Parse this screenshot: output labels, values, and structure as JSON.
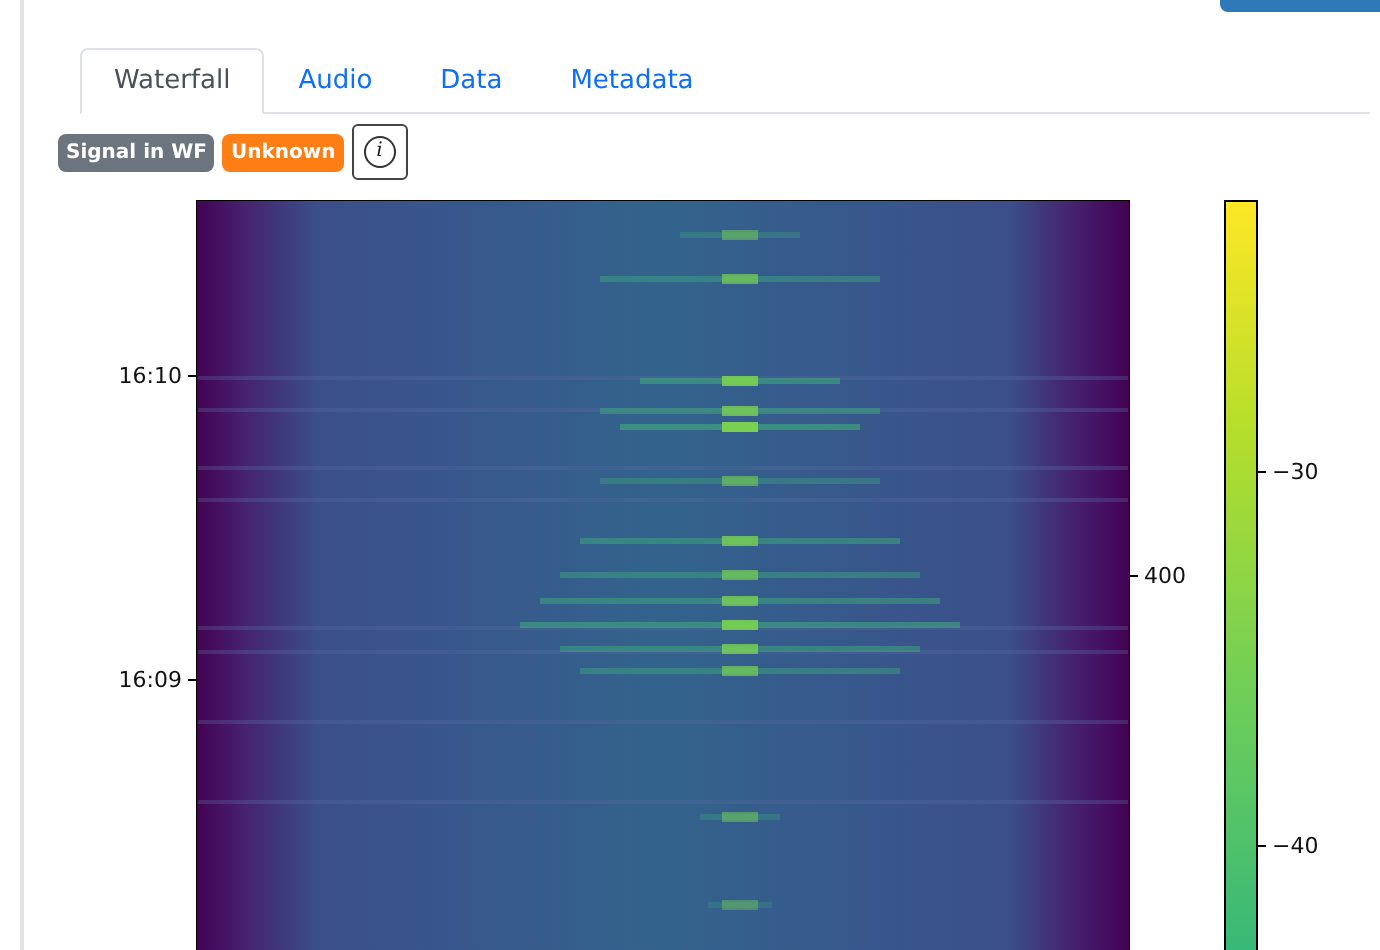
{
  "tabs": [
    {
      "label": "Waterfall",
      "selected": true
    },
    {
      "label": "Audio",
      "selected": false
    },
    {
      "label": "Data",
      "selected": false
    },
    {
      "label": "Metadata",
      "selected": false
    }
  ],
  "badges": [
    {
      "label": "Signal in WF",
      "color": "#6c757d"
    },
    {
      "label": "Unknown",
      "color": "#fd7e14"
    }
  ],
  "info_button": {
    "label": "i"
  },
  "waterfall": {
    "left_ticks": [
      "16:10",
      "16:09"
    ],
    "right_ticks": [
      "400"
    ]
  },
  "colorbar": {
    "ticks": [
      "−30",
      "−40"
    ]
  }
}
